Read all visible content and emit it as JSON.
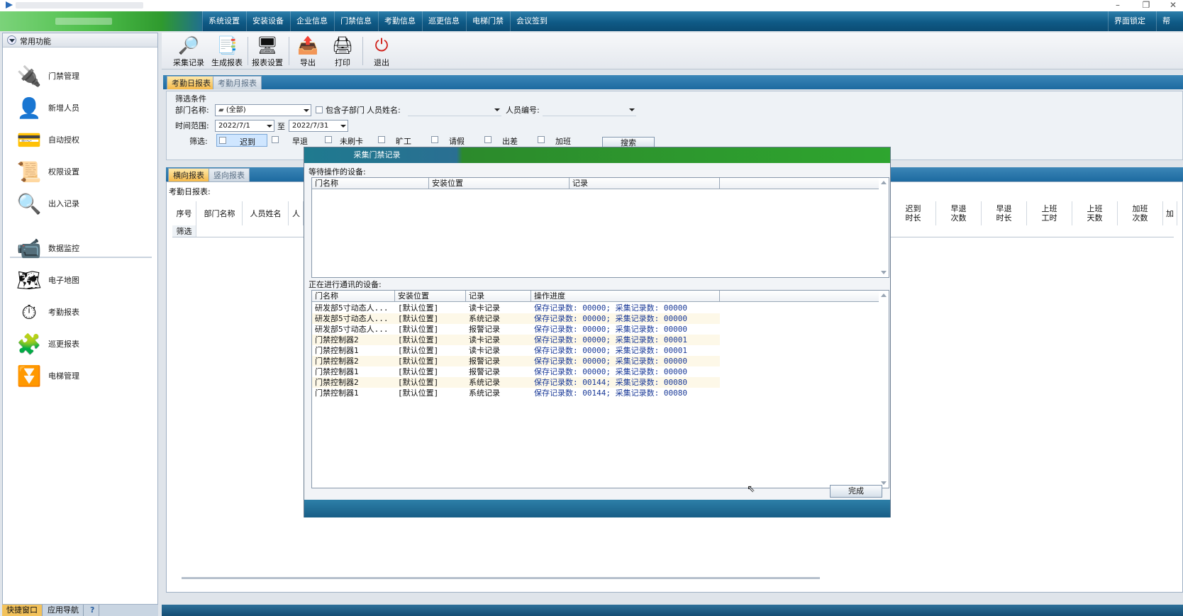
{
  "menu": {
    "items": [
      "系统设置",
      "安装设备",
      "企业信息",
      "门禁信息",
      "考勤信息",
      "巡更信息",
      "电梯门禁",
      "会议签到"
    ],
    "right_items": [
      "界面锁定",
      "帮助"
    ]
  },
  "sidebar": {
    "title": "常用功能",
    "items": [
      {
        "label": "门禁管理",
        "icon": "door-control-icon"
      },
      {
        "label": "新增人员",
        "icon": "person-icon"
      },
      {
        "label": "自动授权",
        "icon": "cards-icon"
      },
      {
        "label": "权限设置",
        "icon": "permission-icon"
      },
      {
        "label": "出入记录",
        "icon": "magnifier-icon"
      },
      {
        "label": "数据监控",
        "icon": "camera-icon"
      },
      {
        "label": "电子地图",
        "icon": "map-icon"
      },
      {
        "label": "考勤报表",
        "icon": "clock-icon"
      },
      {
        "label": "巡更报表",
        "icon": "patrol-icon"
      },
      {
        "label": "电梯管理",
        "icon": "elevator-icon"
      }
    ],
    "bottom_tabs": [
      "快捷窗口",
      "应用导航"
    ]
  },
  "toolbar": {
    "buttons": [
      {
        "label": "采集记录",
        "icon": "collect-icon"
      },
      {
        "label": "生成报表",
        "icon": "generate-report-icon"
      },
      {
        "label": "报表设置",
        "icon": "report-settings-icon"
      },
      {
        "label": "导出",
        "icon": "export-icon"
      },
      {
        "label": "打印",
        "icon": "print-icon"
      },
      {
        "label": "退出",
        "icon": "power-icon"
      }
    ]
  },
  "report_tabs": [
    "考勤日报表",
    "考勤月报表"
  ],
  "filter": {
    "group_title": "筛选条件",
    "dept_label": "部门名称:",
    "dept_value": "(全部)",
    "include_sub_label": "包含子部门",
    "name_label": "人员姓名:",
    "name_value": "",
    "id_label": "人员编号:",
    "id_value": "",
    "time_label": "时间范围:",
    "date_from": "2022/7/1",
    "date_to_word": "至",
    "date_to": "2022/7/31",
    "select_label": "筛选:",
    "options": [
      "迟到",
      "早退",
      "未刷卡",
      "旷工",
      "请假",
      "出差",
      "加班"
    ],
    "search_button": "搜索"
  },
  "view_tabs": [
    "横向报表",
    "竖向报表"
  ],
  "grid": {
    "caption": "考勤日报表:",
    "left_headers": [
      "序号",
      "部门名称",
      "人员姓名",
      "人"
    ],
    "filter_row_label": "筛选",
    "right_headers": [
      "迟到\n时长",
      "早退\n次数",
      "早退\n时长",
      "上班\n工时",
      "上班\n天数",
      "加班\n次数",
      "加"
    ]
  },
  "dialog": {
    "title": "采集门禁记录",
    "waiting_label": "等待操作的设备:",
    "waiting_headers": [
      "门名称",
      "安装位置",
      "记录"
    ],
    "active_label": "正在进行通讯的设备:",
    "active_headers": [
      "门名称",
      "安装位置",
      "记录",
      "操作进度"
    ],
    "rows": [
      {
        "door": "研发部5寸动态人...",
        "location": "[默认位置]",
        "record": "读卡记录",
        "progress": "保存记录数: 00000; 采集记录数: 00000"
      },
      {
        "door": "研发部5寸动态人...",
        "location": "[默认位置]",
        "record": "系统记录",
        "progress": "保存记录数: 00000; 采集记录数: 00000"
      },
      {
        "door": "研发部5寸动态人...",
        "location": "[默认位置]",
        "record": "报警记录",
        "progress": "保存记录数: 00000; 采集记录数: 00000"
      },
      {
        "door": "门禁控制器2",
        "location": "[默认位置]",
        "record": "读卡记录",
        "progress": "保存记录数: 00000; 采集记录数: 00001"
      },
      {
        "door": "门禁控制器1",
        "location": "[默认位置]",
        "record": "读卡记录",
        "progress": "保存记录数: 00000; 采集记录数: 00001"
      },
      {
        "door": "门禁控制器2",
        "location": "[默认位置]",
        "record": "报警记录",
        "progress": "保存记录数: 00000; 采集记录数: 00000"
      },
      {
        "door": "门禁控制器1",
        "location": "[默认位置]",
        "record": "报警记录",
        "progress": "保存记录数: 00000; 采集记录数: 00000"
      },
      {
        "door": "门禁控制器2",
        "location": "[默认位置]",
        "record": "系统记录",
        "progress": "保存记录数: 00144; 采集记录数: 00080"
      },
      {
        "door": "门禁控制器1",
        "location": "[默认位置]",
        "record": "系统记录",
        "progress": "保存记录数: 00144; 采集记录数: 00080"
      }
    ],
    "done_button": "完成"
  },
  "colors": {
    "menu_bar": "#0f5a86",
    "dialog_title_green": "#2ea52f",
    "tab_active": "#f5b94a",
    "progress_text": "#1a3a98"
  }
}
